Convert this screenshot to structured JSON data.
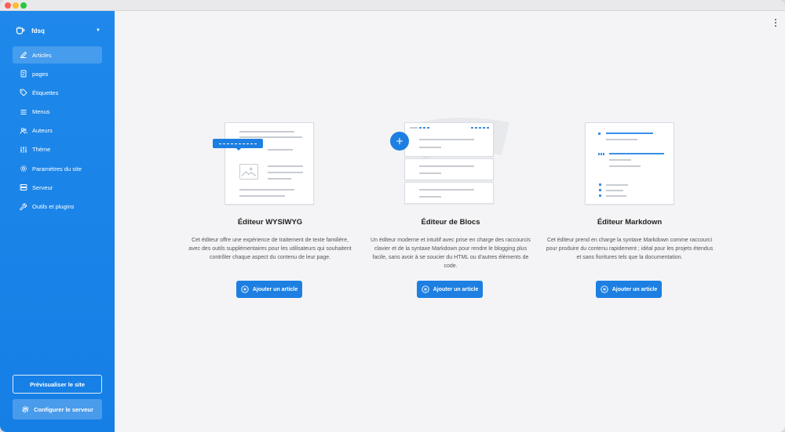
{
  "window": {
    "title": ""
  },
  "sidebar": {
    "site_name": "fdsq",
    "items": [
      {
        "id": "articles",
        "label": "Articles",
        "icon": "pencil-icon",
        "active": true
      },
      {
        "id": "pages",
        "label": "pages",
        "icon": "page-icon",
        "active": false
      },
      {
        "id": "tags",
        "label": "Étiquettes",
        "icon": "tag-icon",
        "active": false
      },
      {
        "id": "menus",
        "label": "Menus",
        "icon": "menu-icon",
        "active": false
      },
      {
        "id": "authors",
        "label": "Auteurs",
        "icon": "users-icon",
        "active": false
      },
      {
        "id": "theme",
        "label": "Thème",
        "icon": "sliders-icon",
        "active": false
      },
      {
        "id": "site-settings",
        "label": "Paramètres du site",
        "icon": "gear-icon",
        "active": false
      },
      {
        "id": "server",
        "label": "Serveur",
        "icon": "server-icon",
        "active": false
      },
      {
        "id": "tools",
        "label": "Outils et plugins",
        "icon": "wrench-icon",
        "active": false
      }
    ],
    "preview_label": "Prévisualiser le site",
    "server_label": "Configurer le serveur"
  },
  "editors": [
    {
      "id": "wysiwyg",
      "title": "Éditeur WYSIWYG",
      "description": "Cet éditeur offre une expérience de traitement de texte familière, avec des outils supplémentaires pour les utilisateurs qui souhaitent contrôler chaque aspect du contenu de leur page.",
      "button_label": "Ajouter un article"
    },
    {
      "id": "blocks",
      "title": "Éditeur de Blocs",
      "description": "Un éditeur moderne et intuitif avec prise en charge des raccourcis clavier et de la syntaxe Markdown pour rendre le blogging plus facile, sans avoir à se soucier du HTML ou d'autres éléments de code.",
      "button_label": "Ajouter un article"
    },
    {
      "id": "markdown",
      "title": "Éditeur Markdown",
      "description": "Cet éditeur prend en charge la syntaxe Markdown comme raccourci pour produire du contenu rapidement ; idéal pour les projets étendus et sans fioritures tels que la documentation.",
      "button_label": "Ajouter un article"
    }
  ],
  "colors": {
    "sidebar": "#1f88ea",
    "accent": "#1d7fe2",
    "background": "#f4f4f6"
  }
}
